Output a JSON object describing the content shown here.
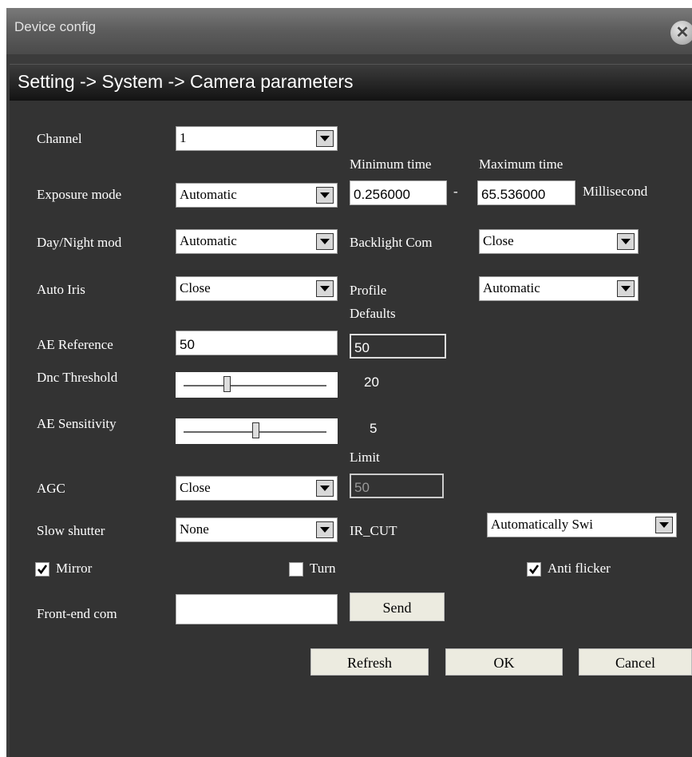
{
  "window": {
    "title": "Device config"
  },
  "breadcrumb": "Setting -> System -> Camera parameters",
  "fields": {
    "channel": {
      "label": "Channel",
      "value": "1"
    },
    "exposure": {
      "label": "Exposure mode",
      "value": "Automatic",
      "min_label": "Minimum time",
      "max_label": "Maximum time",
      "min_value": "0.256000",
      "max_value": "65.536000",
      "dash": "-",
      "unit": "Millisecond"
    },
    "day_night": {
      "label": "Day/Night mod",
      "value": "Automatic"
    },
    "backlight": {
      "label": "Backlight Com",
      "value": "Close"
    },
    "auto_iris": {
      "label": "Auto Iris",
      "value": "Close"
    },
    "profile": {
      "label": "Profile",
      "value": "Automatic"
    },
    "ae_reference": {
      "label": "AE Reference",
      "value": "50",
      "defaults_label": "Defaults",
      "defaults_value": "50"
    },
    "dnc_threshold": {
      "label": "Dnc Threshold",
      "value": "20",
      "fraction": 0.3
    },
    "ae_sensitivity": {
      "label": "AE Sensitivity",
      "value": "5",
      "fraction": 0.5
    },
    "agc": {
      "label": "AGC",
      "value": "Close",
      "limit_label": "Limit",
      "limit_value": "50"
    },
    "slow_shutter": {
      "label": "Slow shutter",
      "value": "None"
    },
    "ir_cut": {
      "label": "IR_CUT",
      "value": "Automatically Swi"
    },
    "mirror": {
      "label": "Mirror",
      "checked": true
    },
    "turn": {
      "label": "Turn",
      "checked": false
    },
    "anti_flicker": {
      "label": "Anti flicker",
      "checked": true
    },
    "front_end": {
      "label": "Front-end com",
      "value": "",
      "send_label": "Send"
    }
  },
  "buttons": {
    "refresh": "Refresh",
    "ok": "OK",
    "cancel": "Cancel"
  },
  "icons": {
    "close": "close-icon",
    "dropdown": "chevron-down-icon",
    "check": "checkmark-icon"
  },
  "colors": {
    "background": "#333333",
    "header": "#141414",
    "button": "#ecebe0"
  }
}
